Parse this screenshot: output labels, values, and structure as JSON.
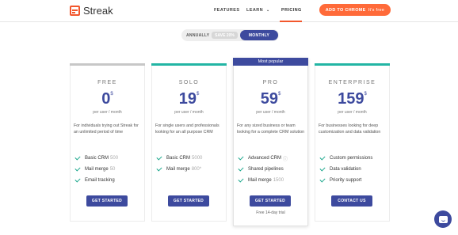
{
  "header": {
    "logo_text": "Streak",
    "nav": {
      "features": "FEATURES",
      "learn": "LEARN",
      "pricing": "PRICING"
    },
    "cta": {
      "label": "ADD TO CHROME",
      "suffix": "It's free"
    }
  },
  "billing_toggle": {
    "annually": "ANNUALLY",
    "save": "SAVE 20%",
    "monthly": "MONTHLY",
    "selected": "MONTHLY"
  },
  "plans": [
    {
      "tier": "FREE",
      "price": "0",
      "currency": "$",
      "per": "per user / month",
      "description": "For individuals trying out Streak for an unlimited period of time",
      "features": [
        {
          "label": "Basic CRM",
          "note": "500"
        },
        {
          "label": "Mail merge",
          "note": "50"
        },
        {
          "label": "Email tracking",
          "note": ""
        }
      ],
      "button": "GET STARTED",
      "accent": "#c7c7c7"
    },
    {
      "tier": "SOLO",
      "price": "19",
      "currency": "$",
      "per": "per user / month",
      "description": "For single users and professionals looking for an all purpose CRM",
      "features": [
        {
          "label": "Basic CRM",
          "note": "5000"
        },
        {
          "label": "Mail merge",
          "note": "800*"
        }
      ],
      "button": "GET STARTED",
      "accent": "#22b5a4"
    },
    {
      "tier": "PRO",
      "badge": "Most popular",
      "price": "59",
      "currency": "$",
      "per": "per user / month",
      "description": "For any sized business or team looking for a complete CRM solution",
      "features": [
        {
          "label": "Advanced CRM",
          "note": "ⓘ"
        },
        {
          "label": "Shared pipelines",
          "note": ""
        },
        {
          "label": "Mail merge",
          "note": "1500"
        }
      ],
      "button": "GET STARTED",
      "trial": "Free 14-day trial",
      "accent": "#3d4a9e"
    },
    {
      "tier": "ENTERPRISE",
      "price": "159",
      "currency": "$",
      "per": "per user / month",
      "description": "For businesses looking for deep customization and data validation",
      "features": [
        {
          "label": "Custom permissions",
          "note": ""
        },
        {
          "label": "Data validation",
          "note": ""
        },
        {
          "label": "Priority support",
          "note": ""
        }
      ],
      "button": "CONTACT US",
      "accent": "#22b5a4"
    }
  ],
  "icons": {
    "check": "check-icon",
    "chat": "chat-icon",
    "logo": "streak-logo-icon",
    "chevron": "chevron-down-icon"
  },
  "colors": {
    "brand": "#3d4a9e",
    "cta": "#ff6a39",
    "check": "#17a68a"
  }
}
